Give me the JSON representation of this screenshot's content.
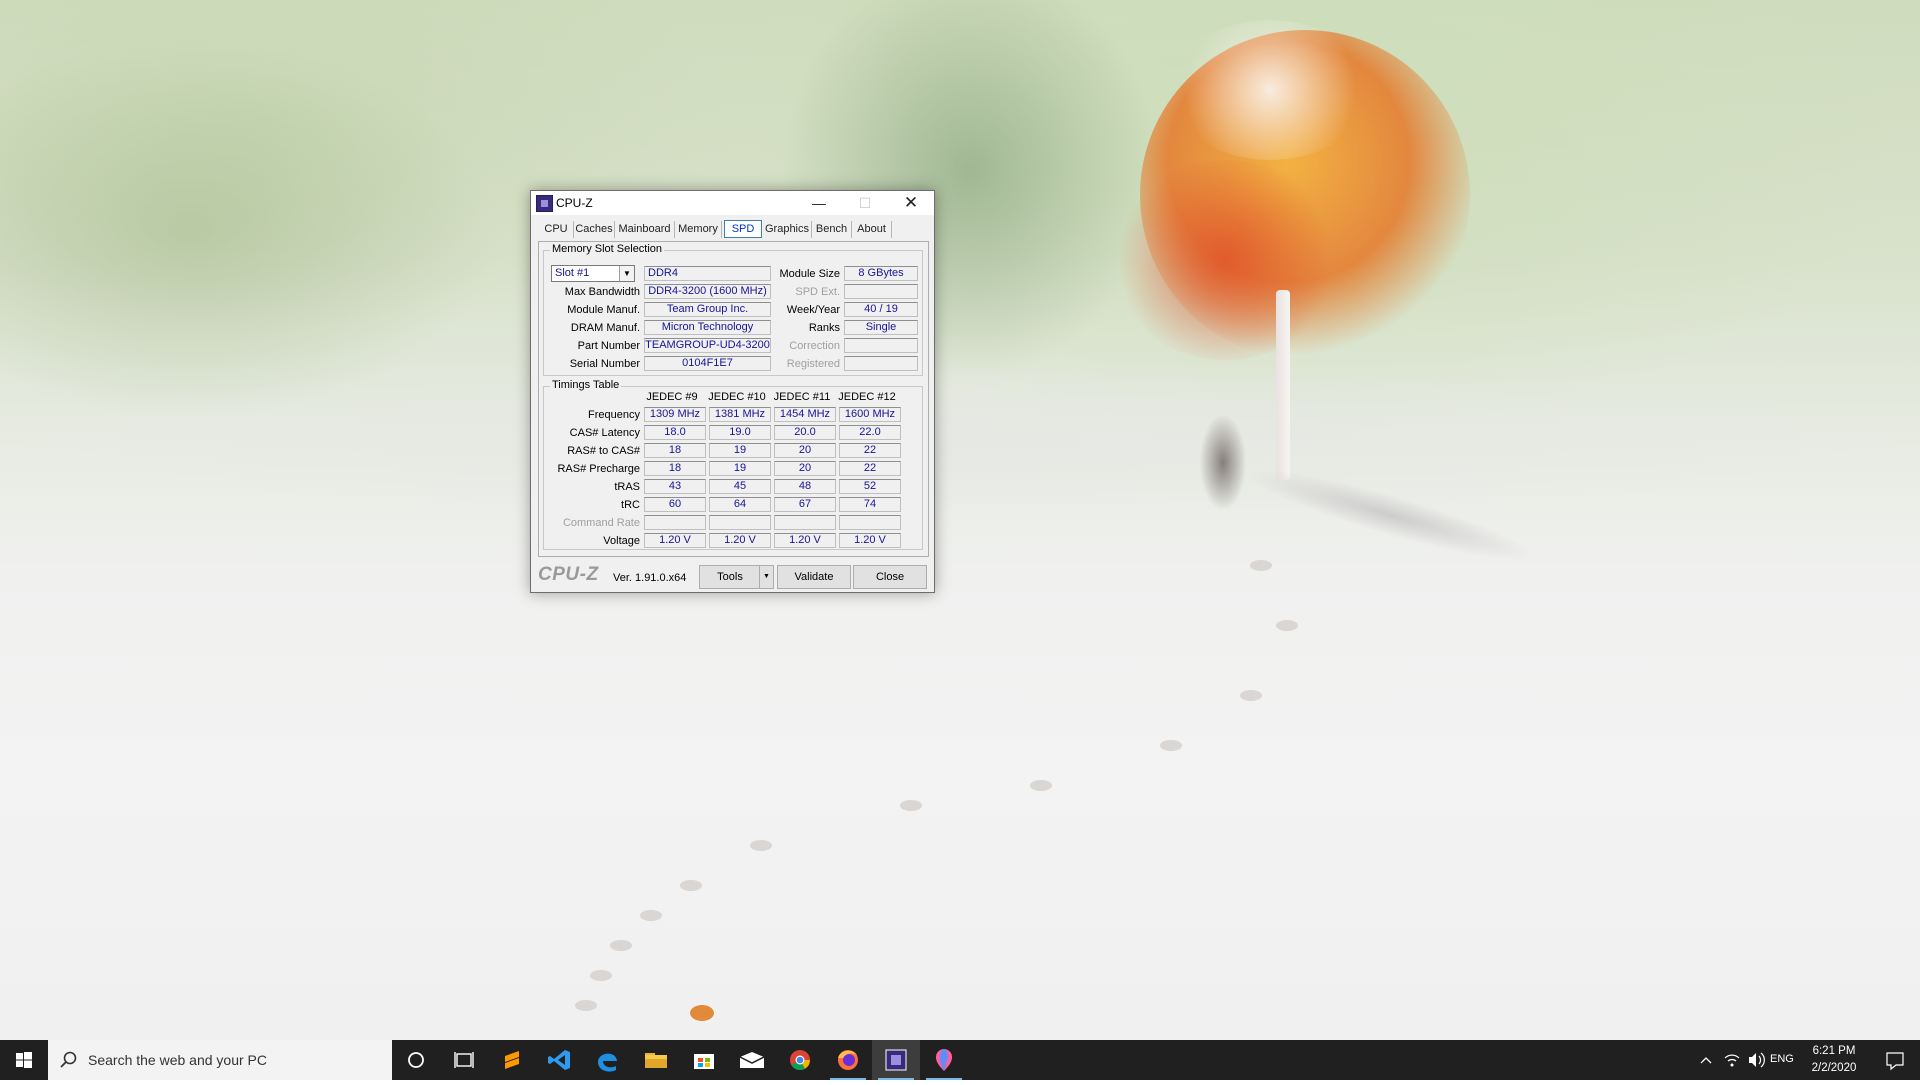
{
  "window": {
    "title": "CPU-Z",
    "tabs": [
      "CPU",
      "Caches",
      "Mainboard",
      "Memory",
      "SPD",
      "Graphics",
      "Bench",
      "About"
    ],
    "active_tab": "SPD"
  },
  "slot_selection": {
    "group_title": "Memory Slot Selection",
    "slot": "Slot #1",
    "type": "DDR4",
    "module_size_label": "Module Size",
    "module_size": "8 GBytes",
    "max_bandwidth_label": "Max Bandwidth",
    "max_bandwidth": "DDR4-3200 (1600 MHz)",
    "spd_ext_label": "SPD Ext.",
    "spd_ext": "",
    "module_manuf_label": "Module Manuf.",
    "module_manuf": "Team Group Inc.",
    "week_year_label": "Week/Year",
    "week_year": "40 / 19",
    "dram_manuf_label": "DRAM Manuf.",
    "dram_manuf": "Micron Technology",
    "ranks_label": "Ranks",
    "ranks": "Single",
    "part_number_label": "Part Number",
    "part_number": "TEAMGROUP-UD4-3200",
    "correction_label": "Correction",
    "correction": "",
    "serial_number_label": "Serial Number",
    "serial_number": "0104F1E7",
    "registered_label": "Registered",
    "registered": ""
  },
  "timings": {
    "group_title": "Timings Table",
    "columns": [
      "JEDEC #9",
      "JEDEC #10",
      "JEDEC #11",
      "JEDEC #12"
    ],
    "rows": [
      {
        "label": "Frequency",
        "dim": false,
        "values": [
          "1309 MHz",
          "1381 MHz",
          "1454 MHz",
          "1600 MHz"
        ]
      },
      {
        "label": "CAS# Latency",
        "dim": false,
        "values": [
          "18.0",
          "19.0",
          "20.0",
          "22.0"
        ]
      },
      {
        "label": "RAS# to CAS#",
        "dim": false,
        "values": [
          "18",
          "19",
          "20",
          "22"
        ]
      },
      {
        "label": "RAS# Precharge",
        "dim": false,
        "values": [
          "18",
          "19",
          "20",
          "22"
        ]
      },
      {
        "label": "tRAS",
        "dim": false,
        "values": [
          "43",
          "45",
          "48",
          "52"
        ]
      },
      {
        "label": "tRC",
        "dim": false,
        "values": [
          "60",
          "64",
          "67",
          "74"
        ]
      },
      {
        "label": "Command Rate",
        "dim": true,
        "values": [
          "",
          "",
          "",
          ""
        ]
      },
      {
        "label": "Voltage",
        "dim": false,
        "values": [
          "1.20 V",
          "1.20 V",
          "1.20 V",
          "1.20 V"
        ]
      }
    ]
  },
  "footer": {
    "brand": "CPU-Z",
    "version": "Ver. 1.91.0.x64",
    "tools_label": "Tools",
    "validate_label": "Validate",
    "close_label": "Close"
  },
  "taskbar": {
    "search_placeholder": "Search the web and your PC",
    "language": "ENG",
    "time": "6:21 PM",
    "date": "2/2/2020",
    "apps": [
      "cortana",
      "task-view",
      "sublime-text",
      "vscode",
      "edge",
      "file-explorer",
      "store",
      "mail",
      "chrome",
      "firefox",
      "cpu-z",
      "paint-3d"
    ]
  },
  "colors": {
    "value_text": "#151595",
    "taskbar_bg": "#202020",
    "tab_highlight": "#3c7fb1"
  }
}
